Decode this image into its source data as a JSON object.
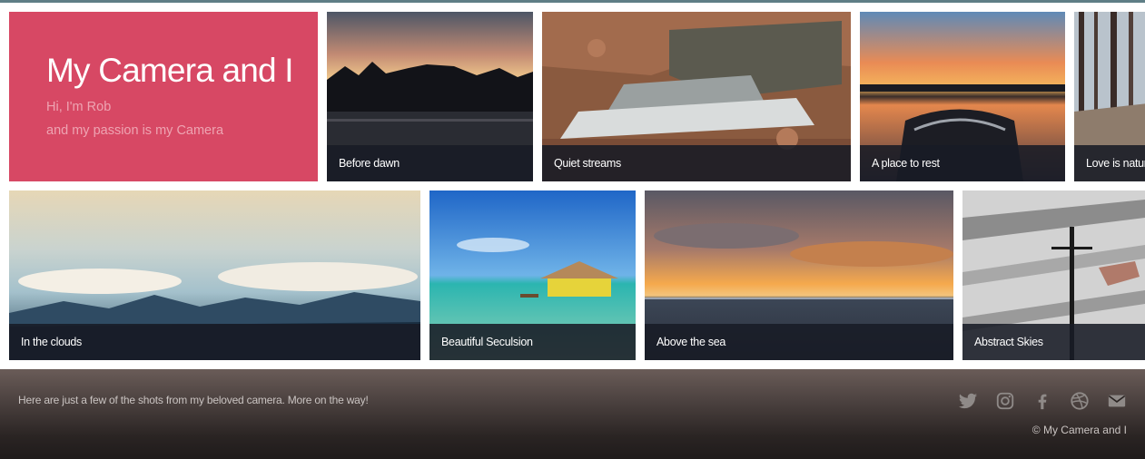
{
  "intro": {
    "title": "My Camera and I",
    "line1": "Hi, I'm Rob",
    "line2": "and my passion is my Camera"
  },
  "gallery": [
    {
      "caption": "Before dawn"
    },
    {
      "caption": "Quiet streams"
    },
    {
      "caption": "A place to rest"
    },
    {
      "caption": "Love is nature"
    },
    {
      "caption": "In the clouds"
    },
    {
      "caption": "Beautiful Seculsion"
    },
    {
      "caption": "Above the sea"
    },
    {
      "caption": "Abstract Skies"
    }
  ],
  "footer": {
    "text": "Here are just a few of the shots from my beloved camera. More on the way!",
    "copyright": "© My Camera and I",
    "social": [
      "twitter-icon",
      "instagram-icon",
      "facebook-icon",
      "dribbble-icon",
      "email-icon"
    ]
  },
  "colors": {
    "intro_bg": "#d74864",
    "caption_bg": "#181b25",
    "footer_bg": "#2a2423",
    "topbar": "#5f7e86"
  }
}
